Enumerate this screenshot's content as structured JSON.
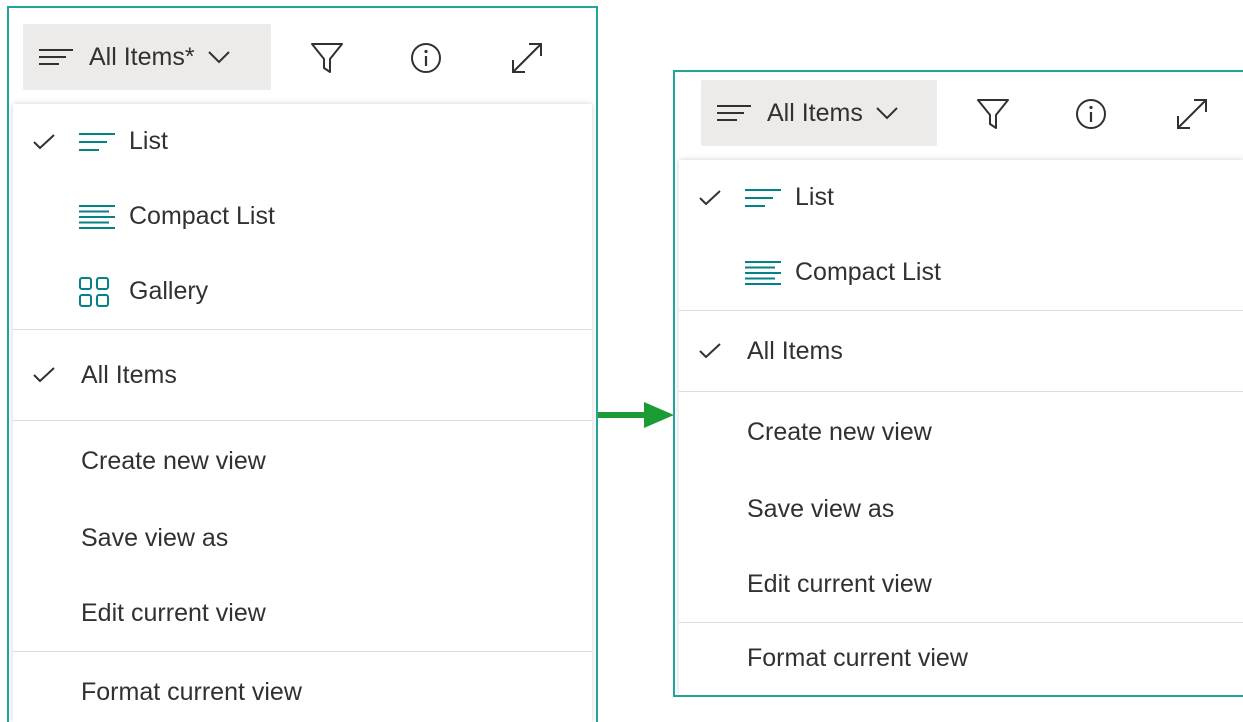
{
  "colors": {
    "panel_border": "#1fa69a",
    "accent_teal": "#038387",
    "arrow_green": "#1a9b34",
    "button_bg": "#edebe9",
    "text": "#323130"
  },
  "left": {
    "view_button_label": "All Items*",
    "toolbar_icons": [
      "hamburger-icon",
      "chevron-down-icon",
      "filter-icon",
      "info-icon",
      "expand-icon"
    ],
    "layout_options": [
      {
        "label": "List",
        "icon": "list-icon",
        "checked": true
      },
      {
        "label": "Compact List",
        "icon": "compact-list-icon",
        "checked": false
      },
      {
        "label": "Gallery",
        "icon": "gallery-icon",
        "checked": false
      }
    ],
    "views": [
      {
        "label": "All Items",
        "checked": true
      }
    ],
    "actions": [
      "Create new view",
      "Save view as",
      "Edit current view"
    ],
    "format": "Format current view"
  },
  "right": {
    "view_button_label": "All Items",
    "toolbar_icons": [
      "hamburger-icon",
      "chevron-down-icon",
      "filter-icon",
      "info-icon",
      "expand-icon"
    ],
    "layout_options": [
      {
        "label": "List",
        "icon": "list-icon",
        "checked": true
      },
      {
        "label": "Compact List",
        "icon": "compact-list-icon",
        "checked": false
      }
    ],
    "views": [
      {
        "label": "All Items",
        "checked": true
      }
    ],
    "actions": [
      "Create new view",
      "Save view as",
      "Edit current view"
    ],
    "format": "Format current view"
  }
}
